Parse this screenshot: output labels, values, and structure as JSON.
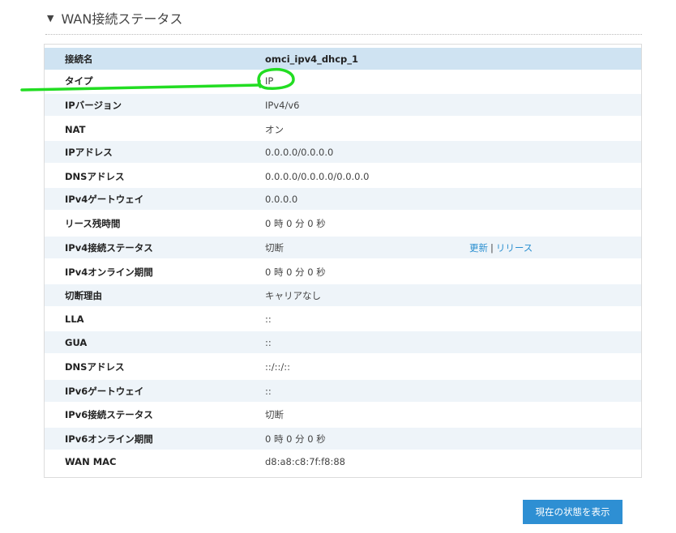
{
  "section": {
    "toggle_icon": "▼",
    "title": "WAN接続ステータス"
  },
  "rows": [
    {
      "label": "接続名",
      "value": "omci_ipv4_dhcp_1"
    },
    {
      "label": "タイプ",
      "value": "IP"
    },
    {
      "label": "IPバージョン",
      "value": "IPv4/v6"
    },
    {
      "label": "NAT",
      "value": "オン"
    },
    {
      "label": "IPアドレス",
      "value": "0.0.0.0/0.0.0.0"
    },
    {
      "label": "DNSアドレス",
      "value": "0.0.0.0/0.0.0.0/0.0.0.0"
    },
    {
      "label": "IPv4ゲートウェイ",
      "value": "0.0.0.0"
    },
    {
      "label": "リース残時間",
      "value": "0 時 0 分 0 秒"
    },
    {
      "label": "IPv4接続ステータス",
      "value": "切断"
    },
    {
      "label": "IPv4オンライン期間",
      "value": "0 時 0 分 0 秒"
    },
    {
      "label": "切断理由",
      "value": "キャリアなし"
    },
    {
      "label": "LLA",
      "value": "::"
    },
    {
      "label": "GUA",
      "value": "::"
    },
    {
      "label": "DNSアドレス",
      "value": "::/::/::"
    },
    {
      "label": "IPv6ゲートウェイ",
      "value": "::"
    },
    {
      "label": "IPv6接続ステータス",
      "value": "切断"
    },
    {
      "label": "IPv6オンライン期間",
      "value": "0 時 0 分 0 秒"
    },
    {
      "label": "WAN MAC",
      "value": "d8:a8:c8:7f:f8:88"
    }
  ],
  "ipv4_actions": {
    "renew": "更新",
    "separator": "|",
    "release": "リリース"
  },
  "buttons": {
    "show_status": "現在の状態を表示"
  },
  "colors": {
    "header_row": "#cfe3f2",
    "alt_row": "#eef4f9",
    "accent": "#2e8fd3",
    "annotation": "#22dd22"
  }
}
